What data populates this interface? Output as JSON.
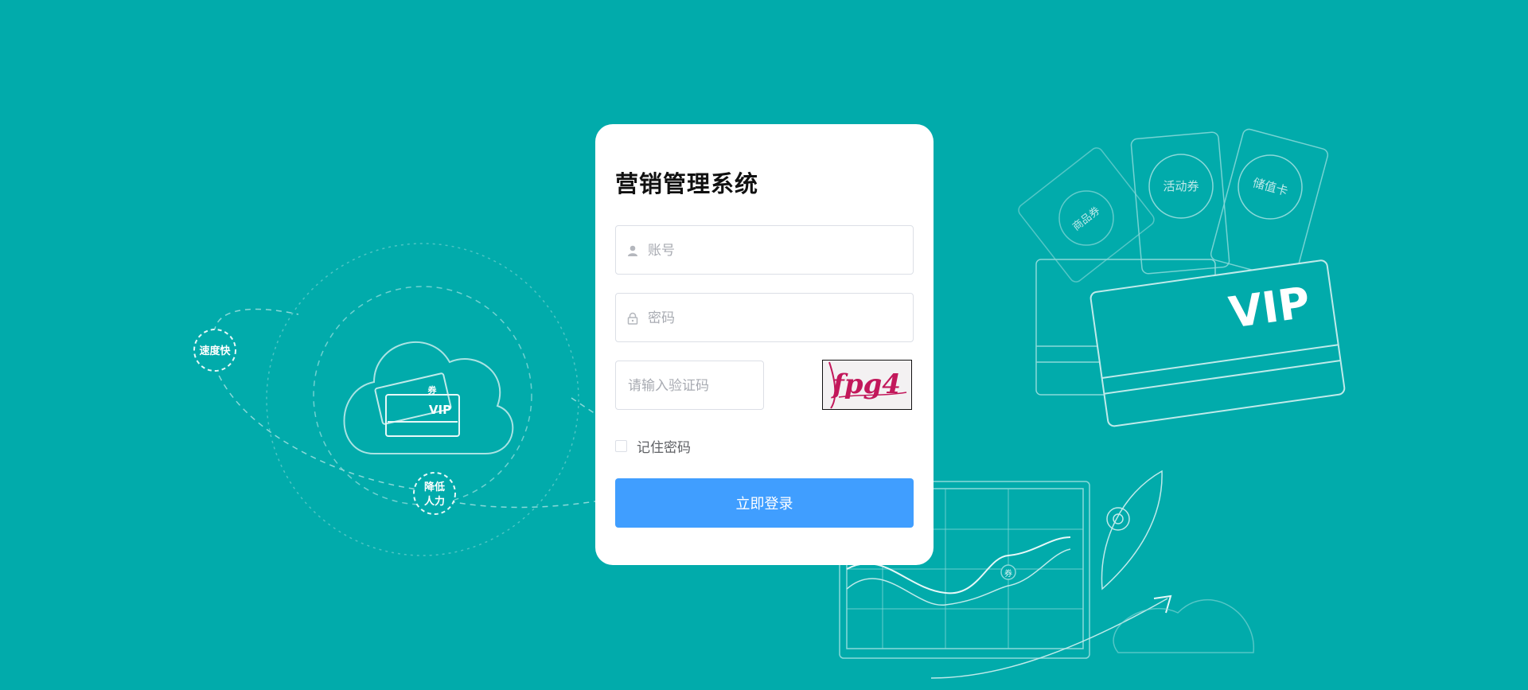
{
  "login": {
    "title": "营销管理系统",
    "username_placeholder": "账号",
    "password_placeholder": "密码",
    "captcha_placeholder": "请输入验证码",
    "captcha_text": "fpg4",
    "remember_label": "记住密码",
    "remember_checked": false,
    "submit_label": "立即登录"
  },
  "illustration": {
    "left_badges": [
      "速度快",
      "降低",
      "人力"
    ],
    "left_card_text": "VIP",
    "left_card_tag": "券",
    "right_coupons": [
      "商品券",
      "活动券",
      "储值卡"
    ],
    "right_card_text": "VIP",
    "chart_marker": "券"
  },
  "colors": {
    "background": "#01ABAB",
    "primary_button": "#409EFF",
    "line_art": "#7fd4d4"
  }
}
